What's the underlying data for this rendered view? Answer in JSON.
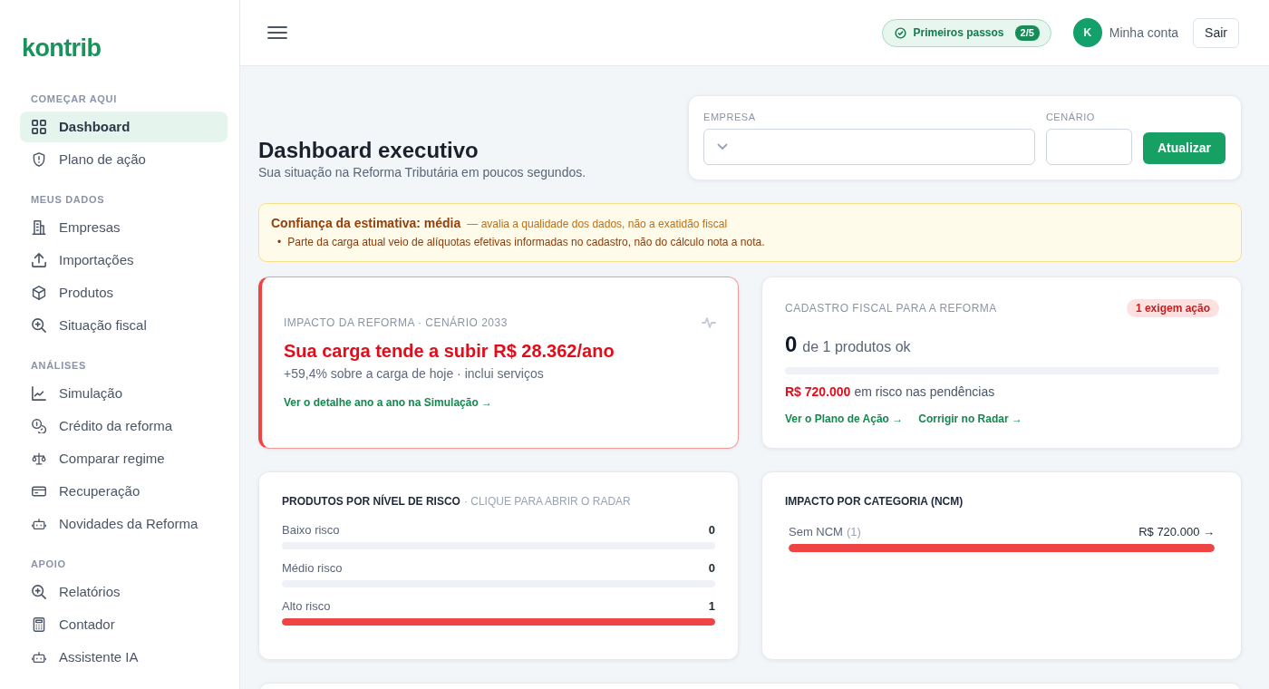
{
  "sidebar": {
    "logo": "kontrib",
    "sections": [
      {
        "title": "COMEÇAR AQUI",
        "items": [
          {
            "label": "Dashboard",
            "selected": true
          },
          {
            "label": "Plano de ação",
            "selected": false
          }
        ]
      },
      {
        "title": "MEUS DADOS",
        "items": [
          {
            "label": "Empresas",
            "selected": false
          },
          {
            "label": "Importações",
            "selected": false
          },
          {
            "label": "Produtos",
            "selected": false
          },
          {
            "label": "Situação fiscal",
            "selected": false
          }
        ]
      },
      {
        "title": "ANÁLISES",
        "items": [
          {
            "label": "Simulação",
            "selected": false
          },
          {
            "label": "Crédito da reforma",
            "selected": false
          },
          {
            "label": "Comparar regime",
            "selected": false
          },
          {
            "label": "Recuperação",
            "selected": false
          },
          {
            "label": "Novidades da Reforma",
            "selected": false
          }
        ]
      },
      {
        "title": "APOIO",
        "items": [
          {
            "label": "Relatórios",
            "selected": false
          },
          {
            "label": "Contador",
            "selected": false
          },
          {
            "label": "Assistente IA",
            "selected": false
          }
        ]
      }
    ]
  },
  "topbar": {
    "onboarding": {
      "label": "Primeiros passos",
      "progress": "2/5"
    },
    "account": {
      "avatar": "K",
      "label": "Minha conta"
    },
    "logout": "Sair"
  },
  "header": {
    "title": "Dashboard executivo",
    "subtitle": "Sua situação na Reforma Tributária em poucos segundos."
  },
  "filters": {
    "fields": [
      {
        "kind": "select",
        "label": "EMPRESA"
      },
      {
        "kind": "input",
        "label": "CENÁRIO"
      }
    ],
    "button": "Atualizar"
  },
  "alert": {
    "title": "Confiança da estimativa: média",
    "note": "— avalia a qualidade dos dados, não a exatidão fiscal",
    "bullets": [
      {
        "marker": "•",
        "text": "Parte da carga atual veio de alíquotas efetivas informadas no cadastro, não do cálculo nota a nota."
      }
    ]
  },
  "impact_card": {
    "label": "IMPACTO DA REFORMA · CENÁRIO 2033",
    "headline": "Sua carga tende a subir R$ 28.362/ano",
    "detail": "+59,4% sobre a carga de hoje · inclui serviços",
    "link": "Ver o detalhe ano a ano na Simulação →"
  },
  "register_card": {
    "label": "CADASTRO FISCAL PARA A REFORMA",
    "badge": "1 exigem ação",
    "count": "0",
    "count_text": "de 1 produtos ok",
    "level": 0,
    "risk_amount": "R$ 720.000",
    "risk_text": "em risco nas pendências",
    "links": [
      "Ver o Plano de Ação →",
      "Corrigir no Radar →"
    ]
  },
  "risk_card": {
    "title": "PRODUTOS POR NÍVEL DE RISCO",
    "hint": "· CLIQUE PARA ABRIR O RADAR",
    "rows": [
      {
        "label": "Baixo risco",
        "count": "0",
        "level": 0
      },
      {
        "label": "Médio risco",
        "count": "0",
        "level": 0
      },
      {
        "label": "Alto risco",
        "count": "1",
        "level": 1
      }
    ]
  },
  "category_card": {
    "title": "IMPACTO POR CATEGORIA (NCM)",
    "rows": [
      {
        "label": "Sem NCM",
        "count": "(1)",
        "value": "R$ 720.000 →",
        "level": 1
      }
    ]
  }
}
